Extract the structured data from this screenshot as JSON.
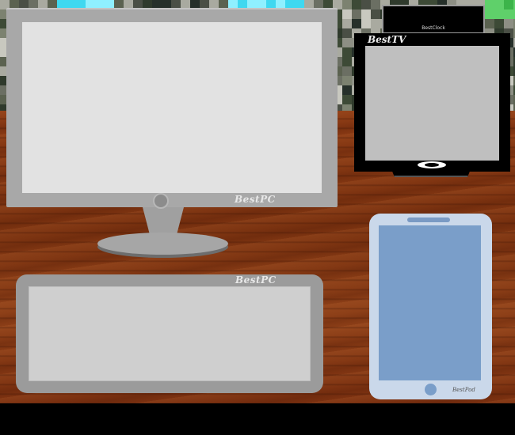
{
  "scene": {
    "monitor": {
      "brand": "BestPC"
    },
    "tablet": {
      "brand": "BestPC"
    },
    "clock": {
      "brand": "BestClock"
    },
    "tv": {
      "brand": "BestTV"
    },
    "phone": {
      "brand": "BestPod"
    }
  },
  "colors": {
    "desk": "#7a3210",
    "device_gray": "#a8a8a8",
    "phone_blue": "#7a9ec9",
    "tv_black": "#000000"
  }
}
